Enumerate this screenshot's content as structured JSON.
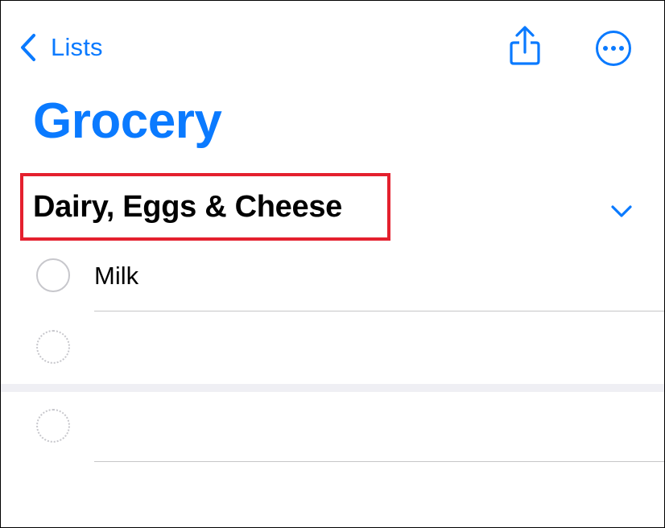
{
  "nav": {
    "back_label": "Lists",
    "back_icon": "chevron-left-icon",
    "share_icon": "share-icon",
    "more_icon": "ellipsis-circle-icon"
  },
  "list": {
    "title": "Grocery"
  },
  "section": {
    "title": "Dairy, Eggs & Cheese",
    "collapse_icon": "chevron-down-icon",
    "highlight_color": "#e4202e",
    "items": [
      {
        "text": "Milk",
        "completed": false
      }
    ]
  },
  "colors": {
    "accent": "#0a7aff",
    "text": "#000000",
    "separator": "#c6c6c8",
    "circle": "#c7c7cc"
  }
}
